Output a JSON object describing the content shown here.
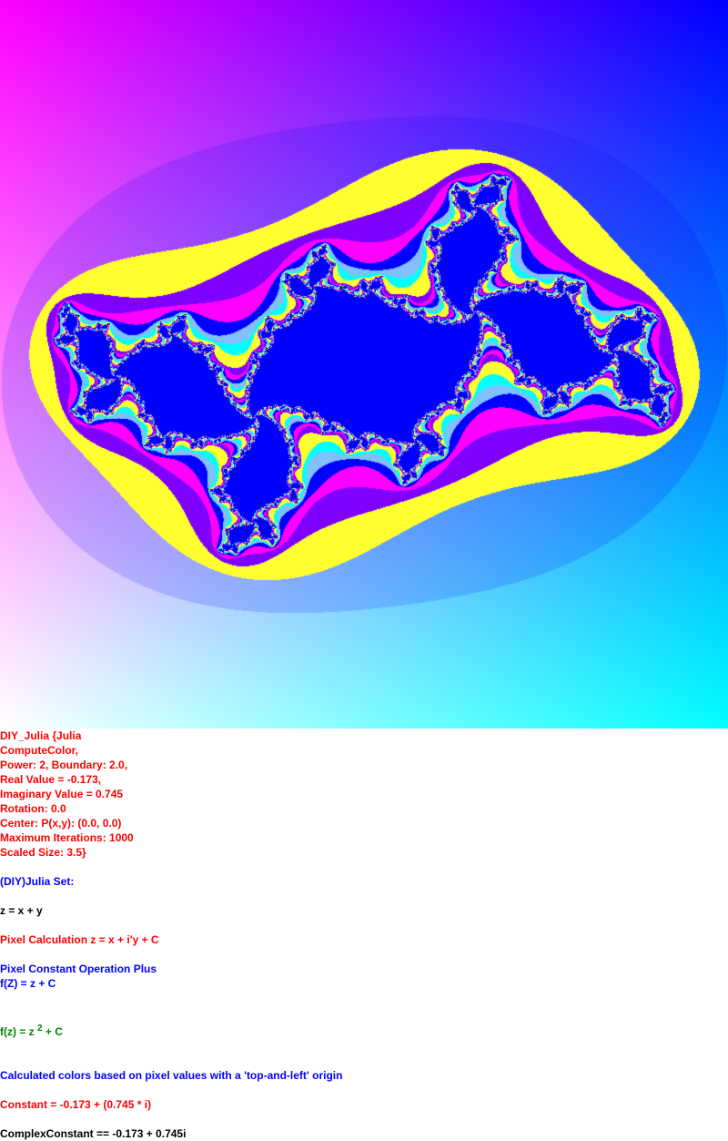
{
  "fractal": {
    "type": "julia",
    "power": 2,
    "c_real": -0.173,
    "c_imag": 0.745,
    "max_iter": 1000,
    "scaled_size": 3.5,
    "rotation": 0.0,
    "center": [
      0.0,
      0.0
    ],
    "colors": {
      "interior": "#0000ff",
      "band_yellow": "#ffff30",
      "band_magenta": "#ff00ff",
      "band_cyan": "#00ffff",
      "band_violet": "#8000ff",
      "band_light_blue": "#80c0ff",
      "bg_topleft": "#ff00ff",
      "bg_topright": "#0000ff",
      "bg_bottomleft": "#ffffff",
      "bg_bottomright": "#00ffff"
    }
  },
  "info": {
    "l1": "DIY_Julia {Julia",
    "l2": "ComputeColor,",
    "l3": "Power: 2, Boundary: 2.0,",
    "l4": "Real Value = -0.173,",
    "l5": "Imaginary Value = 0.745",
    "l6": "Rotation: 0.0",
    "l7": "Center: P(x,y): (0.0, 0.0)",
    "l8": "Maximum Iterations: 1000",
    "l9": "Scaled Size: 3.5}",
    "julia_set": "(DIY)Julia Set:",
    "z_eq": "z = x + y",
    "pixel_calc": "Pixel Calculation z = x + i'y + C",
    "pixel_const_op": "Pixel Constant Operation Plus",
    "fZ": "f(Z) = z + C",
    "fz_pre": "f(z) = z ",
    "fz_exp": "2",
    "fz_post": " + C",
    "calc_colors": "Calculated colors based on pixel values with a 'top-and-left' origin",
    "constant": "Constant = -0.173 + (0.745 * i)",
    "complex_constant": "ComplexConstant == -0.173 + 0.745i"
  }
}
